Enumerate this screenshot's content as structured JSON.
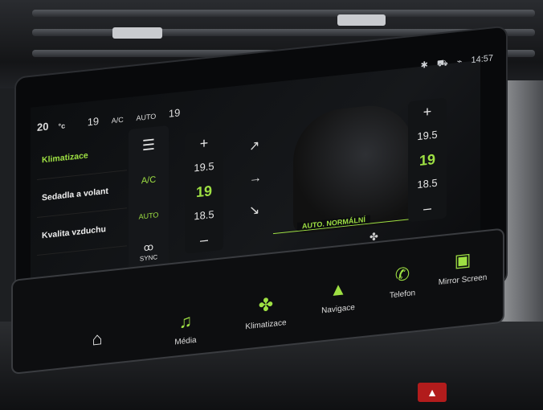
{
  "status": {
    "time": "14:57"
  },
  "climate": {
    "temp_left": "20",
    "temp_left_unit": "°c",
    "temp_top": "19",
    "ac": "A/C",
    "auto": "AUTO",
    "temp_right_top": "19"
  },
  "menu": {
    "items": [
      "Klimatizace",
      "Sedadla a volant",
      "Kvalita vzduchu"
    ]
  },
  "controls": {
    "ac": "A/C",
    "auto": "AUTO",
    "sync": "SYNC"
  },
  "left_temp": {
    "plus": "+",
    "upper": "19.5",
    "current": "19",
    "lower": "18.5",
    "minus": "–"
  },
  "right_temp": {
    "plus": "+",
    "upper": "19.5",
    "current": "19",
    "lower": "18.5",
    "minus": "–"
  },
  "mode": "AUTO. NORMÁLNÍ",
  "bottom_nav": {
    "media": "Média",
    "climate": "Klimatizace",
    "navigation": "Navigace",
    "phone": "Telefon",
    "mirror": "Mirror Screen"
  },
  "colors": {
    "accent": "#9ee043",
    "hazard": "#b21c1c"
  }
}
